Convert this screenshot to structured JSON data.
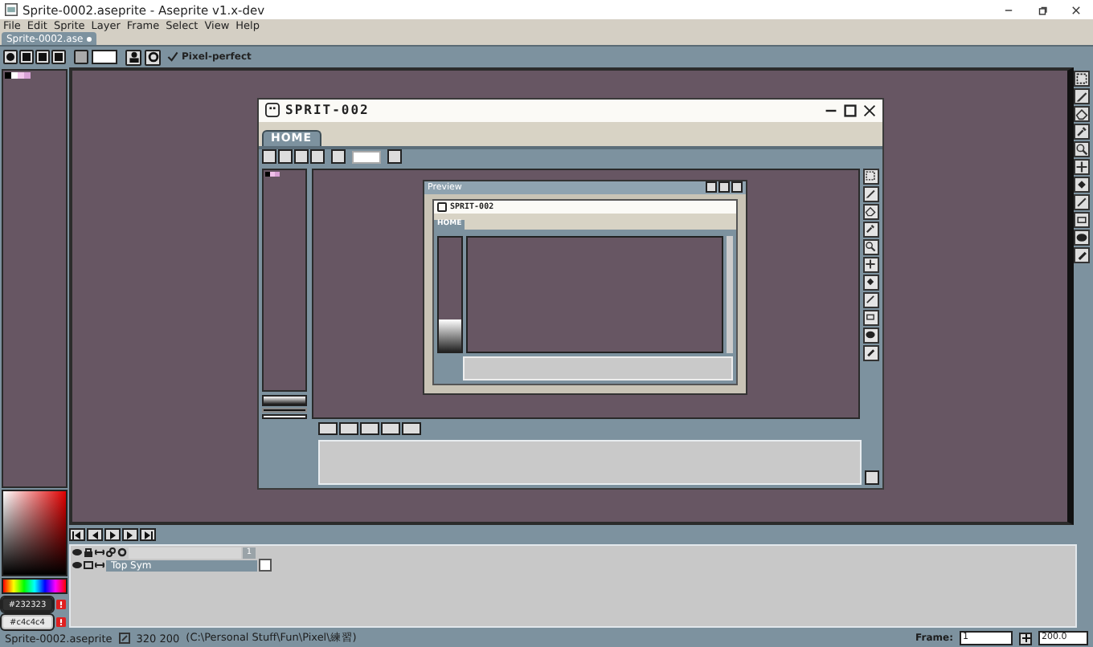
{
  "window": {
    "title": "Sprite-0002.aseprite - Aseprite v1.x-dev"
  },
  "menu": [
    "File",
    "Edit",
    "Sprite",
    "Layer",
    "Frame",
    "Select",
    "View",
    "Help"
  ],
  "tabs": [
    {
      "label": "Sprite-0002.ase",
      "selected": true,
      "modified": true
    }
  ],
  "context_bar": {
    "pixel_perfect": {
      "label": "Pixel-perfect",
      "checked": true
    }
  },
  "palette": {
    "swatches": [
      {
        "color": "#000000"
      },
      {
        "color": "#ffffff"
      },
      {
        "color": "#f2c6ec"
      },
      {
        "color": "#d8a2d6"
      }
    ]
  },
  "colors": {
    "foreground": "#232323",
    "background": "#c4c4c4"
  },
  "sprite": {
    "title": "SPRIT-002",
    "tab": "HOME",
    "preview": {
      "title": "Preview",
      "inner_title": "SPRIT-002",
      "inner_tab": "HOME"
    }
  },
  "timeline": {
    "layers": [
      {
        "name": "Top Sym",
        "visible": true
      }
    ],
    "frames": [
      "1"
    ]
  },
  "status_bar": {
    "file": "Sprite-0002.aseprite",
    "size": "320 200",
    "path": "(C:\\Personal Stuff\\Fun\\Pixel\\練習)",
    "frame_label": "Frame:",
    "frame": "1",
    "zoom": "200.0"
  }
}
